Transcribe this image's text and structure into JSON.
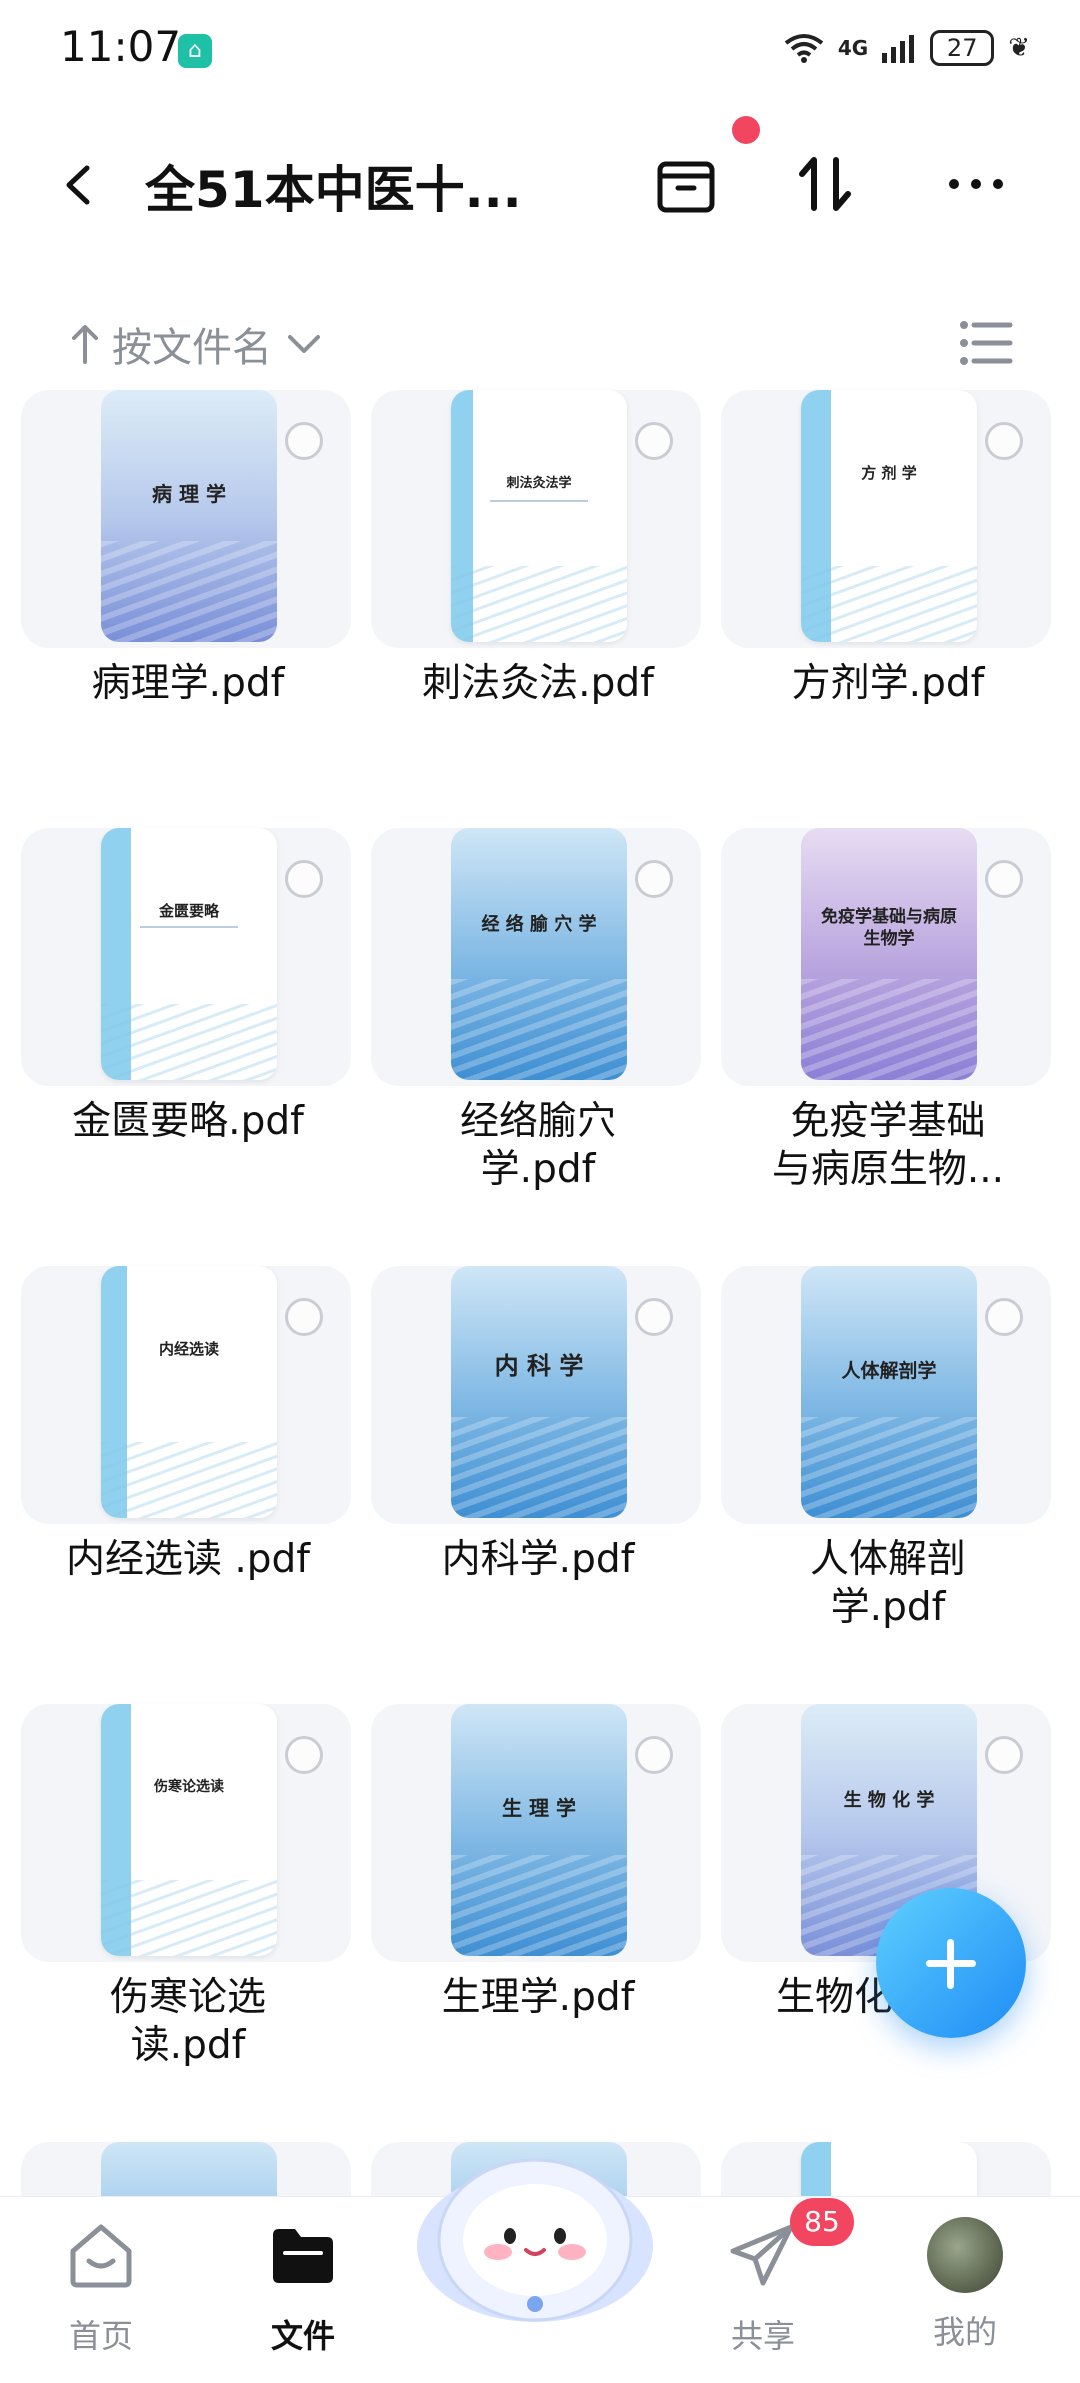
{
  "status_bar": {
    "time": "11:07",
    "network": "4G",
    "battery": "27"
  },
  "header": {
    "title": "全51本中医十...",
    "back_icon": "chevron-left-icon",
    "actions": [
      "archive-icon",
      "sort-arrows-icon",
      "more-icon"
    ]
  },
  "sort": {
    "label": "按文件名",
    "direction_icon": "arrow-up-icon"
  },
  "files": [
    {
      "name": "病理学.pdf",
      "cover_title": "病 理 学",
      "style": "blue-light"
    },
    {
      "name": "刺法灸法.pdf",
      "cover_title": "刺法灸法学",
      "style": "white"
    },
    {
      "name": "方剂学.pdf",
      "cover_title": "方 剂 学",
      "style": "white"
    },
    {
      "name": "金匮要略.pdf",
      "cover_title": "金匮要略",
      "style": "white"
    },
    {
      "name": "经络腧穴学.pdf",
      "cover_title": "经 络 腧 穴 学",
      "style": "blue"
    },
    {
      "name": "免疫学基础与病原生物...",
      "cover_title": "免疫学基础与病原生物学",
      "style": "purple"
    },
    {
      "name": "内经选读 .pdf",
      "cover_title": "内经选读",
      "style": "white"
    },
    {
      "name": "内科学.pdf",
      "cover_title": "内 科 学",
      "style": "blue"
    },
    {
      "name": "人体解剖学.pdf",
      "cover_title": "人体解剖学",
      "style": "blue"
    },
    {
      "name": "伤寒论选读.pdf",
      "cover_title": "伤寒论选读",
      "style": "white"
    },
    {
      "name": "生理学.pdf",
      "cover_title": "生 理 学",
      "style": "blue"
    },
    {
      "name": "生物化",
      "cover_title": "生 物 化 学",
      "style": "mixed"
    }
  ],
  "nav": {
    "home": "首页",
    "files": "文件",
    "share": "共享",
    "mine": "我的",
    "share_badge": "85"
  },
  "colors": {
    "accent_blue": "#1e8cf5",
    "badge_red": "#f2455f",
    "muted_text": "#8a8f98"
  }
}
